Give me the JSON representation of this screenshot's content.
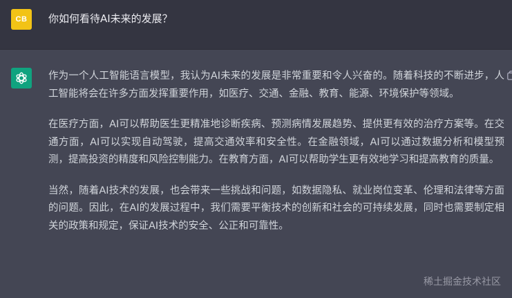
{
  "user": {
    "avatar_initials": "CB",
    "question": "你如何看待AI未来的发展？"
  },
  "assistant": {
    "avatar_icon": "openai-logo-icon",
    "paragraphs": [
      "作为一个人工智能语言模型，我认为AI未来的发展是非常重要和令人兴奋的。随着科技的不断进步，人工智能将会在许多方面发挥重要作用，如医疗、交通、金融、教育、能源、环境保护等领域。",
      "在医疗方面，AI可以帮助医生更精准地诊断疾病、预测病情发展趋势、提供更有效的治疗方案等。在交通方面，AI可以实现自动驾驶，提高交通效率和安全性。在金融领域，AI可以通过数据分析和模型预测，提高投资的精度和风险控制能力。在教育方面，AI可以帮助学生更有效地学习和提高教育的质量。",
      "当然，随着AI技术的发展，也会带来一些挑战和问题，如数据隐私、就业岗位变革、伦理和法律等方面的问题。因此，在AI的发展过程中，我们需要平衡技术的创新和社会的可持续发展，同时也需要制定相关的政策和规定，保证AI技术的安全、公正和可靠性。"
    ]
  },
  "watermark": "稀土掘金技术社区",
  "colors": {
    "user_bg": "#343541",
    "assistant_bg": "#444654",
    "user_avatar": "#f2c316",
    "assistant_avatar": "#10a37f",
    "text": "#d1d5db"
  }
}
